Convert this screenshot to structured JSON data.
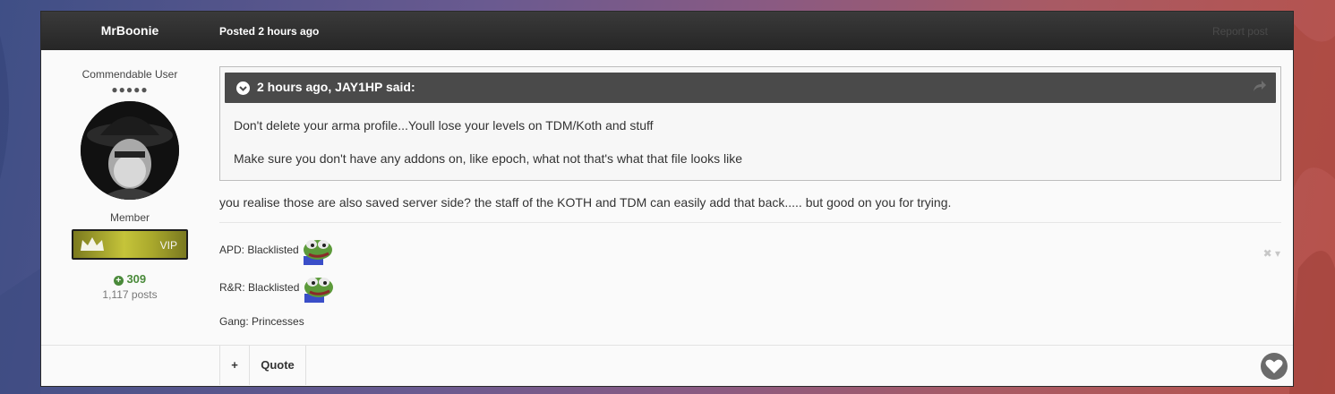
{
  "post": {
    "author": "MrBoonie",
    "posted": "Posted 2 hours ago",
    "report_label": "Report post"
  },
  "author_info": {
    "rank_title": "Commendable User",
    "rank_pips": "●●●●●",
    "group": "Member",
    "badge_label": "VIP",
    "reputation": "309",
    "post_count": "1,117 posts"
  },
  "quote": {
    "citation": "2 hours ago, JAY1HP said:",
    "lines": [
      "Don't delete your arma profile...Youll lose your levels on TDM/Koth and stuff",
      "Make sure you don't have any addons on, like epoch, what not that's what that file looks like"
    ]
  },
  "body": "you realise those are also saved server side? the staff of the KOTH and TDM can easily add that back..... but good on you for trying.",
  "signature": {
    "lines": [
      "APD: Blacklisted",
      "R&R: Blacklisted",
      "Gang: Princesses"
    ]
  },
  "footer": {
    "plus_label": "+",
    "quote_label": "Quote"
  },
  "icons": {
    "quote_toggle": "chevron-down-icon",
    "share": "share-icon",
    "reputation": "plus-circle-icon",
    "signature_close": "close-icon",
    "like": "heart-icon"
  }
}
